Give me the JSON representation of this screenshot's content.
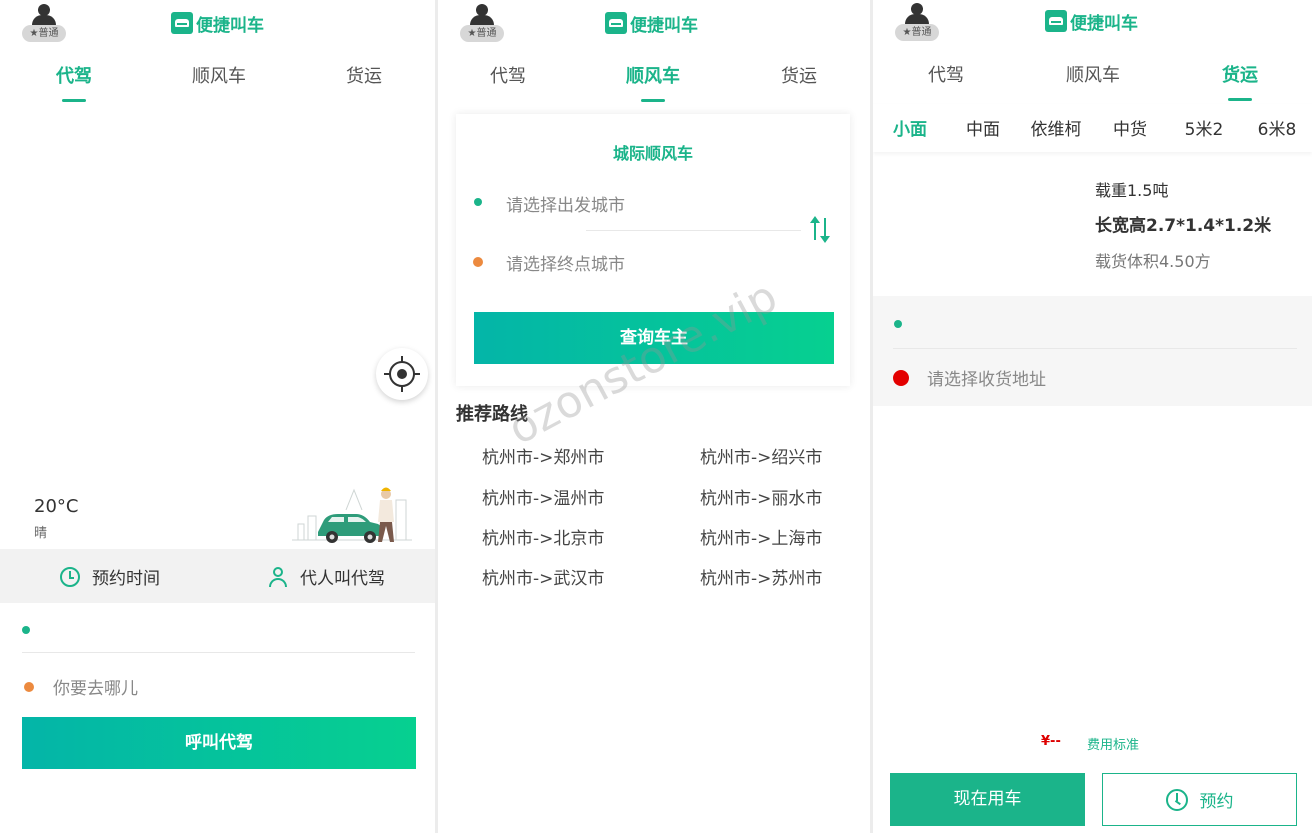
{
  "header": {
    "badge": "★普通",
    "brand": "便捷叫车"
  },
  "tabs": [
    "代驾",
    "顺风车",
    "货运"
  ],
  "screen1": {
    "weather": {
      "temp": "20°C",
      "desc": "晴"
    },
    "options": {
      "reserve": "预约时间",
      "proxy": "代人叫代驾"
    },
    "destination_placeholder": "你要去哪儿",
    "call_button": "呼叫代驾"
  },
  "screen2": {
    "card_title": "城际顺风车",
    "from_placeholder": "请选择出发城市",
    "to_placeholder": "请选择终点城市",
    "search_button": "查询车主",
    "section_title": "推荐路线",
    "routes": [
      "杭州市->郑州市",
      "杭州市->绍兴市",
      "杭州市->温州市",
      "杭州市->丽水市",
      "杭州市->北京市",
      "杭州市->上海市",
      "杭州市->武汉市",
      "杭州市->苏州市"
    ],
    "watermark": "ozonstore.vip"
  },
  "screen3": {
    "vehicle_types": [
      "小面",
      "中面",
      "依维柯",
      "中货",
      "5米2",
      "6米8"
    ],
    "specs": {
      "load": "载重1.5吨",
      "size": "长宽高2.7*1.4*1.2米",
      "volume": "载货体积4.50方"
    },
    "receive_placeholder": "请选择收货地址",
    "price": "¥--",
    "price_link": "费用标准",
    "now_button": "现在用车",
    "book_button": "预约"
  },
  "colors": {
    "accent": "#1bb48a",
    "gradient_start": "#04b5a8",
    "gradient_end": "#06d090",
    "origin_dot": "#1bb48a",
    "dest_dot": "#ec8a3f",
    "receive_dot": "#e30000"
  },
  "icons": [
    "user-icon",
    "car-logo-icon",
    "locate-icon",
    "clock-icon",
    "person-icon",
    "swap-icon"
  ]
}
